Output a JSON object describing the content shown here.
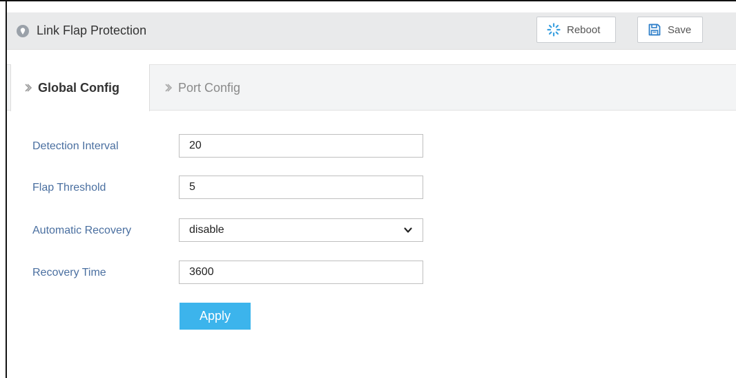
{
  "header": {
    "title": "Link Flap Protection",
    "title_icon": "location-pin-icon",
    "reboot_label": "Reboot",
    "reboot_icon": "spinner-icon",
    "save_label": "Save",
    "save_icon": "floppy-disk-icon"
  },
  "tabs": [
    {
      "label": "Global Config",
      "active": true
    },
    {
      "label": "Port Config",
      "active": false
    }
  ],
  "form": {
    "detection_interval": {
      "label": "Detection Interval",
      "value": "20"
    },
    "flap_threshold": {
      "label": "Flap Threshold",
      "value": "5"
    },
    "automatic_recovery": {
      "label": "Automatic Recovery",
      "value": "disable"
    },
    "recovery_time": {
      "label": "Recovery Time",
      "value": "3600"
    }
  },
  "apply_label": "Apply",
  "colors": {
    "label_text": "#4a6fa0",
    "apply_button": "#3cb4ec",
    "reboot_icon": "#3aa0e0",
    "save_icon": "#2f7fc9",
    "header_bg": "#e9eaeb",
    "tabbar_bg": "#f3f4f5"
  }
}
